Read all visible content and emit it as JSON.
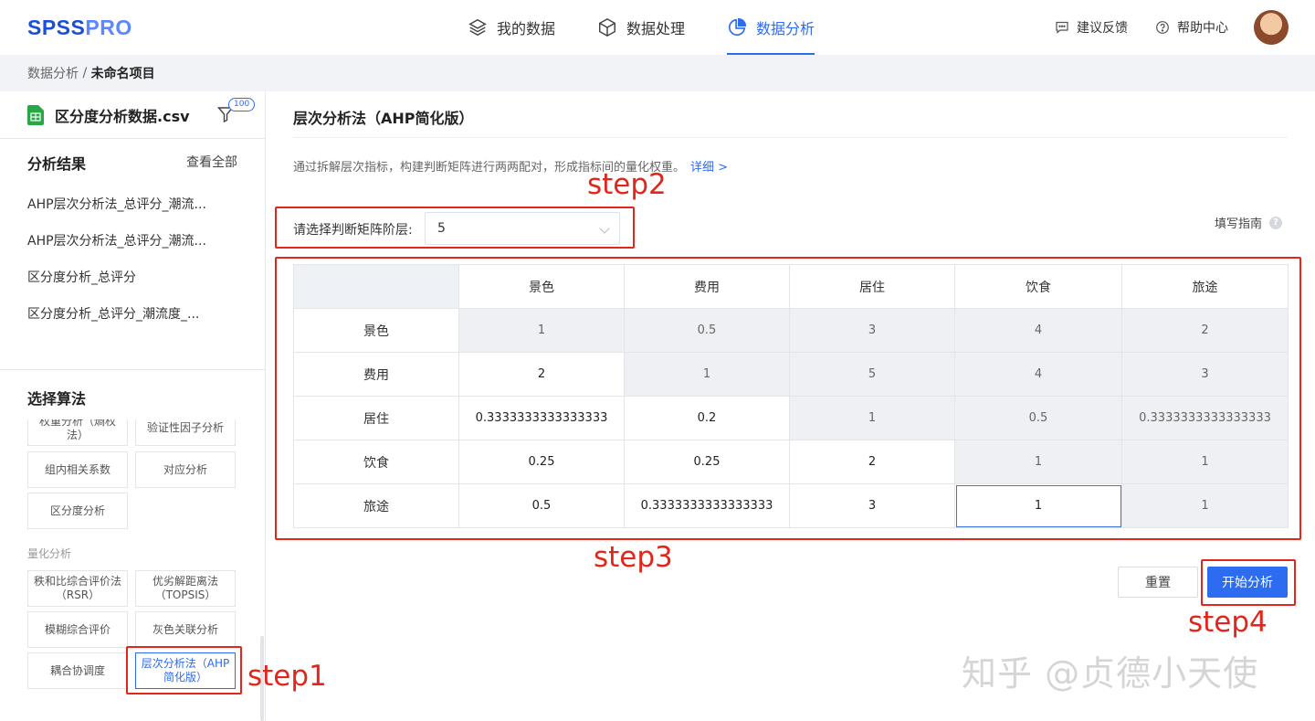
{
  "brand": {
    "part1": "SPSS",
    "part2": "PRO",
    "color": "#1c4fd8"
  },
  "nav": {
    "tabs": [
      {
        "label": "我的数据",
        "icon": "layers-icon"
      },
      {
        "label": "数据处理",
        "icon": "cube-icon"
      },
      {
        "label": "数据分析",
        "icon": "pie-chart-icon",
        "active": true
      }
    ],
    "feedback": "建议反馈",
    "help": "帮助中心"
  },
  "breadcrumb": {
    "root": "数据分析",
    "sep": " / ",
    "current": "未命名项目"
  },
  "sidebar": {
    "file_name": "区分度分析数据.csv",
    "filter_count": "100",
    "results_title": "分析结果",
    "view_all": "查看全部",
    "results": [
      "AHP层次分析法_总评分_潮流...",
      "AHP层次分析法_总评分_潮流...",
      "区分度分析_总评分",
      "区分度分析_总评分_潮流度_..."
    ],
    "algo_title": "选择算法",
    "algos_top": [
      "权重分析（熵权法）",
      "验证性因子分析",
      "组内相关系数",
      "对应分析",
      "区分度分析"
    ],
    "quant_label": "量化分析",
    "algos_quant": [
      "秩和比综合评价法（RSR）",
      "优劣解距离法（TOPSIS）",
      "模糊综合评价",
      "灰色关联分析",
      "耦合协调度",
      "层次分析法（AHP简化版）"
    ]
  },
  "main": {
    "title": "层次分析法（AHP简化版）",
    "description": "通过拆解层次指标，构建判断矩阵进行两两配对，形成指标间的量化权重。",
    "detail_link": "详细 >",
    "level_label": "请选择判断矩阵阶层:",
    "level_value": "5",
    "guide": "填写指南",
    "guide_icon": "question-icon",
    "columns": [
      "景色",
      "费用",
      "居住",
      "饮食",
      "旅途"
    ],
    "rows": [
      {
        "label": "景色",
        "cells": [
          "1",
          "0.5",
          "3",
          "4",
          "2"
        ]
      },
      {
        "label": "费用",
        "cells": [
          "2",
          "1",
          "5",
          "4",
          "3"
        ]
      },
      {
        "label": "居住",
        "cells": [
          "0.3333333333333333",
          "0.2",
          "1",
          "0.5",
          "0.3333333333333333"
        ]
      },
      {
        "label": "饮食",
        "cells": [
          "0.25",
          "0.25",
          "2",
          "1",
          "1"
        ]
      },
      {
        "label": "旅途",
        "cells": [
          "0.5",
          "0.3333333333333333",
          "3",
          "1",
          "1"
        ]
      }
    ],
    "reset_label": "重置",
    "start_label": "开始分析",
    "accent": "#2d6bf0"
  },
  "annotations": {
    "step1": "step1",
    "step2": "step2",
    "step3": "step3",
    "step4": "step4",
    "color": "#e3261b"
  },
  "watermark": "知乎 @贞德小天使"
}
